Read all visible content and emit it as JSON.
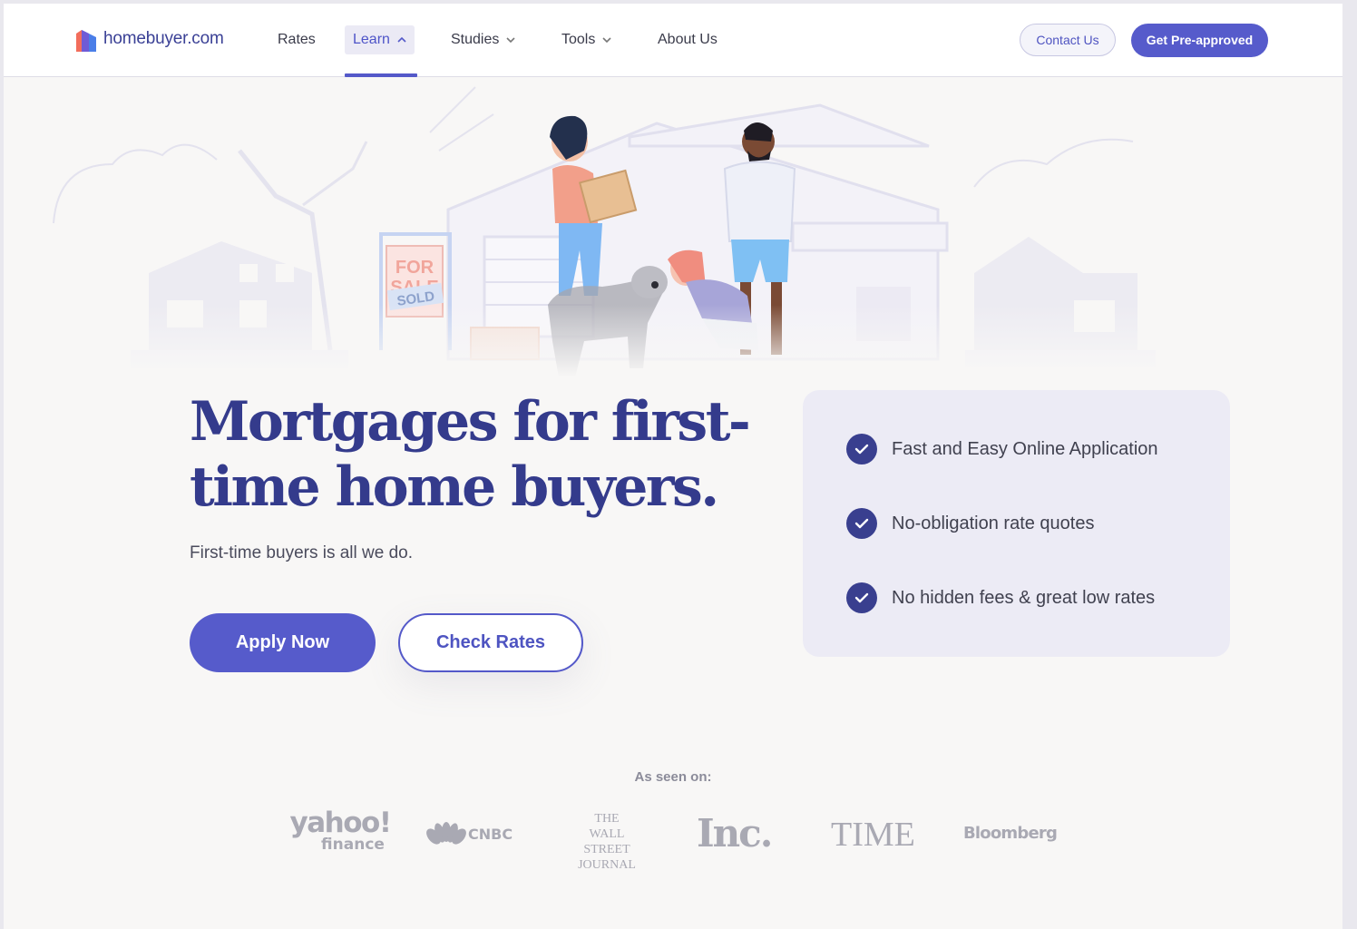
{
  "brand": {
    "name": "homebuyer.com"
  },
  "nav": {
    "items": [
      {
        "label": "Rates"
      },
      {
        "label": "Learn"
      },
      {
        "label": "Studies"
      },
      {
        "label": "Tools"
      },
      {
        "label": "About Us"
      }
    ],
    "contact_label": "Contact Us",
    "preapproved_label": "Get Pre-approved"
  },
  "hero": {
    "sign_for": "FOR",
    "sign_sale": "SALE",
    "sign_sold": "SOLD",
    "headline": "Mortgages for first-time home buyers.",
    "subhead": "First-time buyers is all we do.",
    "apply_label": "Apply Now",
    "check_label": "Check Rates"
  },
  "features": [
    {
      "text": "Fast and Easy Online Application"
    },
    {
      "text": "No-obligation rate quotes"
    },
    {
      "text": "No hidden fees & great low rates"
    }
  ],
  "press": {
    "label": "As seen on:",
    "logos": [
      {
        "name": "yahoo!",
        "sub": "finance"
      },
      {
        "name": "CNBC"
      },
      {
        "name": "THE",
        "line2": "WALL STREET",
        "line3": "JOURNAL"
      },
      {
        "name": "Inc."
      },
      {
        "name": "TIME"
      },
      {
        "name": "Bloomberg"
      }
    ]
  },
  "colors": {
    "primary": "#565bcb",
    "headline": "#343b8c",
    "panel": "#ecebf5",
    "check": "#393f8f"
  }
}
